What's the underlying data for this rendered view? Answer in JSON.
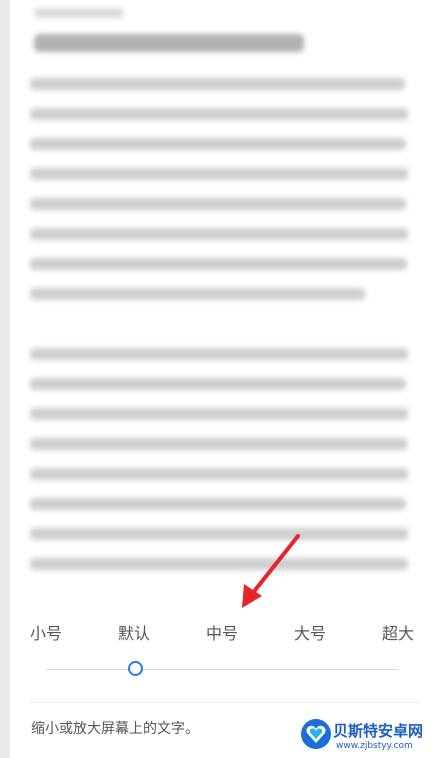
{
  "font_size_sizes": [
    {
      "label": "小号"
    },
    {
      "label": "默认"
    },
    {
      "label": "中号"
    },
    {
      "label": "大号"
    },
    {
      "label": "超大"
    }
  ],
  "slider": {
    "selected_index": 1,
    "accent": "#2e78e6"
  },
  "description": "缩小或放大屏幕上的文字。",
  "annotation": {
    "arrow_color": "#e5252a"
  },
  "watermark": {
    "title": "贝斯特安卓网",
    "url": "www.zjbstyy.com",
    "logo": "heart-shield-logo-icon"
  }
}
